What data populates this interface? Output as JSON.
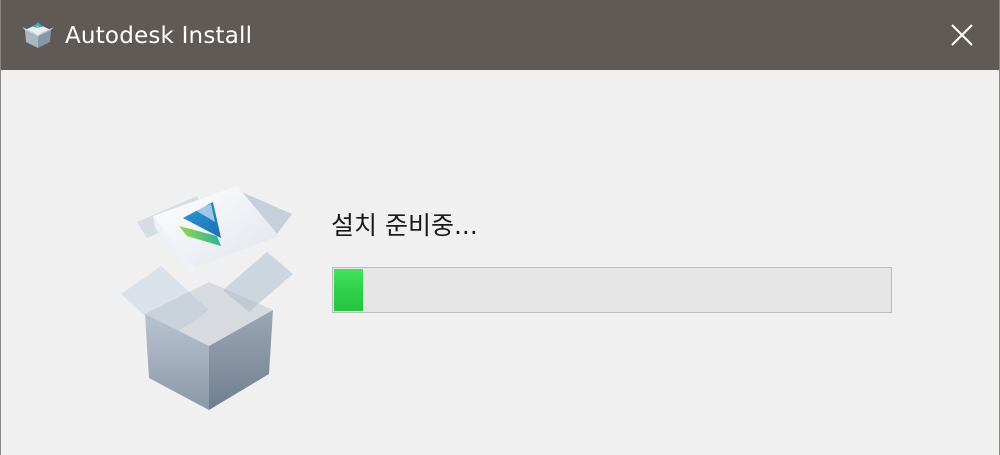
{
  "window": {
    "title": "Autodesk Install",
    "title_icon": "autodesk-install-box-icon",
    "close_icon": "close-icon"
  },
  "install": {
    "status_text": "설치 준비중...",
    "progress_fraction": 0.053,
    "illustration": "autodesk-package-box-icon"
  },
  "colors": {
    "titlebar": "#5f5a55",
    "background": "#f0f0f0",
    "progress_fill": "#2fd14a",
    "progress_track": "#e6e6e6"
  }
}
